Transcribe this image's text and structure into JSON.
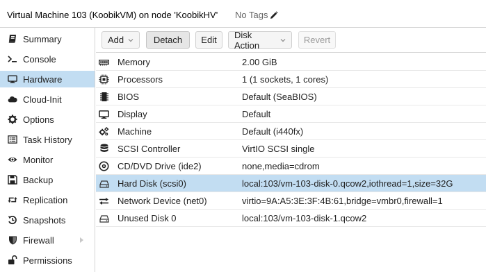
{
  "header": {
    "title": "Virtual Machine 103 (KoobikVM) on node 'KoobikHV'",
    "tags_label": "No Tags"
  },
  "sidebar": {
    "items": [
      {
        "label": "Summary",
        "icon": "summary-icon"
      },
      {
        "label": "Console",
        "icon": "console-icon"
      },
      {
        "label": "Hardware",
        "icon": "monitor-icon",
        "selected": true
      },
      {
        "label": "Cloud-Init",
        "icon": "cloud-icon"
      },
      {
        "label": "Options",
        "icon": "gear-icon"
      },
      {
        "label": "Task History",
        "icon": "list-icon"
      },
      {
        "label": "Monitor",
        "icon": "eye-icon"
      },
      {
        "label": "Backup",
        "icon": "floppy-icon"
      },
      {
        "label": "Replication",
        "icon": "retweet-icon"
      },
      {
        "label": "Snapshots",
        "icon": "history-icon"
      },
      {
        "label": "Firewall",
        "icon": "shield-icon",
        "has_arrow": true
      },
      {
        "label": "Permissions",
        "icon": "unlock-icon"
      }
    ]
  },
  "toolbar": {
    "add_label": "Add",
    "detach_label": "Detach",
    "edit_label": "Edit",
    "disk_action_label": "Disk Action",
    "revert_label": "Revert"
  },
  "hardware": {
    "rows": [
      {
        "label": "Memory",
        "value": "2.00 GiB",
        "icon": "memory-icon"
      },
      {
        "label": "Processors",
        "value": "1 (1 sockets, 1 cores)",
        "icon": "cpu-icon"
      },
      {
        "label": "BIOS",
        "value": "Default (SeaBIOS)",
        "icon": "chip-icon"
      },
      {
        "label": "Display",
        "value": "Default",
        "icon": "desktop-icon"
      },
      {
        "label": "Machine",
        "value": "Default (i440fx)",
        "icon": "cogs-icon"
      },
      {
        "label": "SCSI Controller",
        "value": "VirtIO SCSI single",
        "icon": "database-icon"
      },
      {
        "label": "CD/DVD Drive (ide2)",
        "value": "none,media=cdrom",
        "icon": "cdrom-icon"
      },
      {
        "label": "Hard Disk (scsi0)",
        "value": "local:103/vm-103-disk-0.qcow2,iothread=1,size=32G",
        "icon": "hdd-icon",
        "selected": true
      },
      {
        "label": "Network Device (net0)",
        "value": "virtio=9A:A5:3E:3F:4B:61,bridge=vmbr0,firewall=1",
        "icon": "exchange-icon"
      },
      {
        "label": "Unused Disk 0",
        "value": "local:103/vm-103-disk-1.qcow2",
        "icon": "hdd-icon"
      }
    ]
  },
  "colors": {
    "selection": "#c2ddf2",
    "border": "#d4d4d4"
  }
}
